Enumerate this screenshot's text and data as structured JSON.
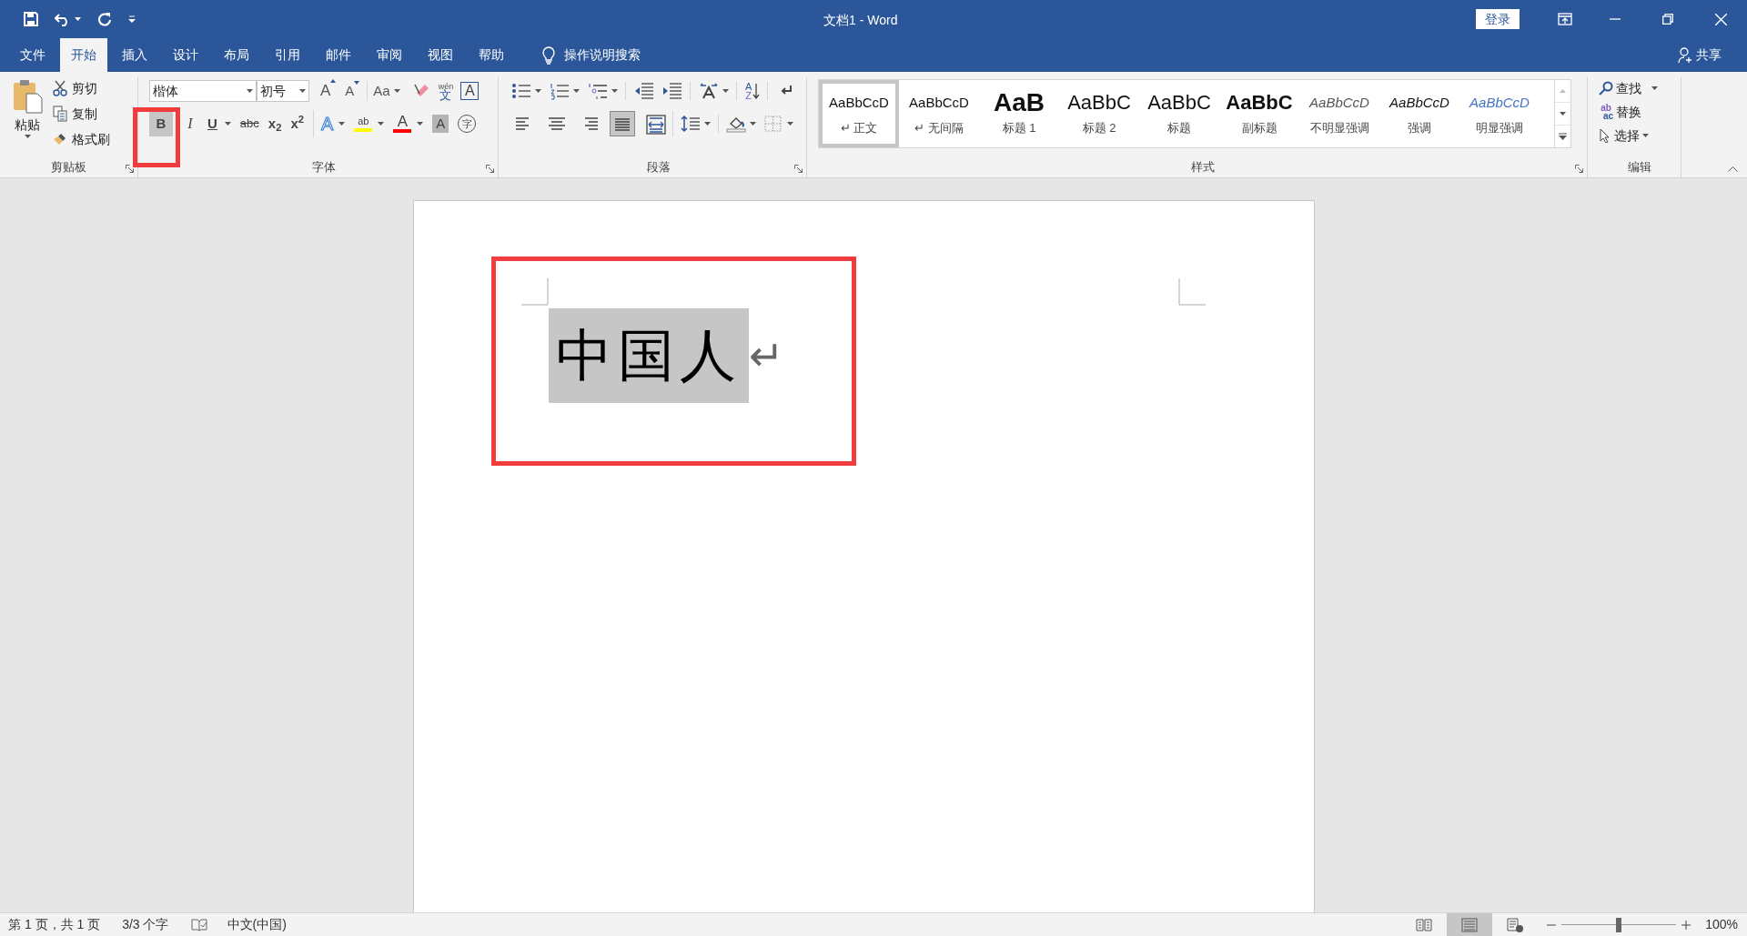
{
  "window": {
    "title": "文档1  -  Word",
    "sign_in": "登录"
  },
  "tabs": [
    {
      "label": "文件",
      "selected": false
    },
    {
      "label": "开始",
      "selected": true
    },
    {
      "label": "插入",
      "selected": false
    },
    {
      "label": "设计",
      "selected": false
    },
    {
      "label": "布局",
      "selected": false
    },
    {
      "label": "引用",
      "selected": false
    },
    {
      "label": "邮件",
      "selected": false
    },
    {
      "label": "审阅",
      "selected": false
    },
    {
      "label": "视图",
      "selected": false
    },
    {
      "label": "帮助",
      "selected": false
    }
  ],
  "tell_me": {
    "placeholder": "操作说明搜索"
  },
  "share": "共享",
  "clipboard": {
    "label": "剪贴板",
    "paste": "粘贴",
    "items": [
      {
        "kind": "cut",
        "label": "剪切"
      },
      {
        "kind": "copy",
        "label": "复制"
      },
      {
        "kind": "painter",
        "label": "格式刷"
      }
    ]
  },
  "font": {
    "label": "字体",
    "font_name": "楷体",
    "font_size": "初号",
    "row1": [
      {
        "kind": "grow",
        "label": "A"
      },
      {
        "kind": "shrink",
        "label": "A"
      },
      {
        "kind": "case",
        "label": "Aa"
      },
      {
        "kind": "clear"
      },
      {
        "kind": "phonetic",
        "label": "wén",
        "sub": "文"
      },
      {
        "kind": "border",
        "label": "A"
      }
    ],
    "row2": [
      {
        "kind": "bold",
        "label": "B",
        "selected": true
      },
      {
        "kind": "italic",
        "label": "I",
        "selected": false
      },
      {
        "kind": "underline",
        "label": "U",
        "selected": false
      },
      {
        "kind": "strike",
        "label": "abc",
        "selected": false
      },
      {
        "kind": "script",
        "label": "x$_{2}$",
        "selected": false
      },
      {
        "kind": "script",
        "label": "x$^{2}$",
        "selected": false
      },
      {
        "kind": "effects",
        "label": "A"
      },
      {
        "kind": "highlight",
        "label": "ab",
        "color": "#ffff00"
      },
      {
        "kind": "color",
        "label": "A",
        "color": "#ff0000"
      },
      {
        "kind": "shading",
        "label": "A"
      },
      {
        "kind": "enclose",
        "label": "字"
      }
    ]
  },
  "paragraph": {
    "label": "段落",
    "sort": {
      "top": "A",
      "bottom": "Z"
    },
    "alignments": [
      {
        "kind": "left",
        "selected": false
      },
      {
        "kind": "center",
        "selected": false
      },
      {
        "kind": "right",
        "selected": false
      },
      {
        "kind": "justify",
        "selected": true
      },
      {
        "kind": "distribute",
        "selected": false
      }
    ]
  },
  "styles": {
    "label": "样式",
    "items": [
      {
        "kind": "normal",
        "preview": "AaBbCcD",
        "name": "↵ 正文",
        "selected": true
      },
      {
        "kind": "normal",
        "preview": "AaBbCcD",
        "name": "↵ 无间隔",
        "selected": false
      },
      {
        "kind": "heading1",
        "preview": "AaB",
        "name": "标题 1",
        "selected": false
      },
      {
        "kind": "heading",
        "preview": "AaBbC",
        "name": "标题 2",
        "selected": false
      },
      {
        "kind": "heading",
        "preview": "AaBbC",
        "name": "标题",
        "selected": false
      },
      {
        "kind": "subtitle",
        "preview": "AaBbC",
        "name": "副标题",
        "selected": false
      },
      {
        "kind": "subtle",
        "preview": "AaBbCcD",
        "name": "不明显强调",
        "selected": false
      },
      {
        "kind": "emphasis",
        "preview": "AaBbCcD",
        "name": "强调",
        "selected": false
      },
      {
        "kind": "intense",
        "preview": "AaBbCcD",
        "name": "明显强调",
        "selected": false
      }
    ]
  },
  "editing": {
    "label": "编辑",
    "items": [
      {
        "kind": "find",
        "label": "查找"
      },
      {
        "kind": "replace",
        "label": "替换",
        "icon_top": "ab",
        "icon_bottom": "ac"
      },
      {
        "kind": "select",
        "label": "选择"
      }
    ]
  },
  "document": {
    "text": "中国人",
    "selected": true,
    "paragraph_mark": "↵"
  },
  "status_bar": {
    "page": "第 1 页，共 1 页",
    "words": "3/3 个字",
    "language": "中文(中国)",
    "views": [
      {
        "kind": "read",
        "selected": false
      },
      {
        "kind": "print",
        "selected": true
      },
      {
        "kind": "web",
        "selected": false
      }
    ],
    "zoom": {
      "level": 0.5,
      "label": "100%"
    }
  }
}
